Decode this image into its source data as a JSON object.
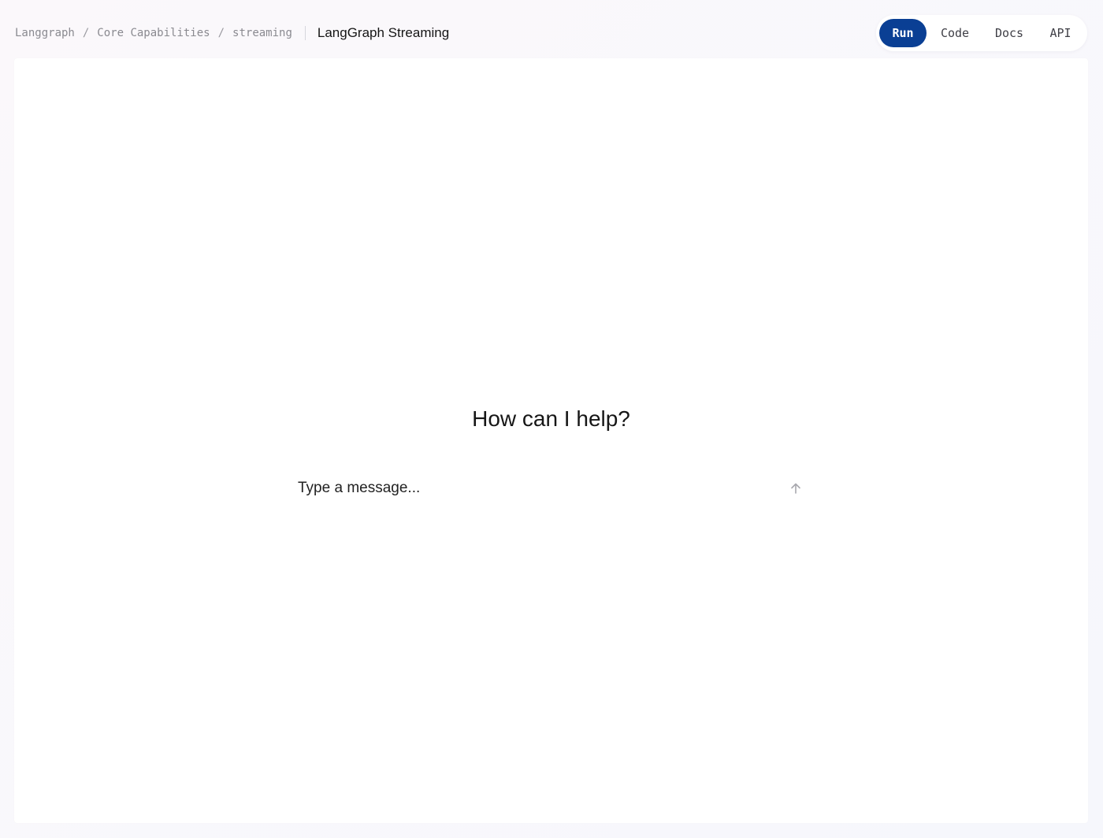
{
  "header": {
    "breadcrumb": {
      "items": [
        "Langgraph",
        "Core Capabilities",
        "streaming"
      ],
      "separator": "/"
    },
    "page_title": "LangGraph Streaming",
    "tabs": [
      {
        "label": "Run",
        "active": true
      },
      {
        "label": "Code",
        "active": false
      },
      {
        "label": "Docs",
        "active": false
      },
      {
        "label": "API",
        "active": false
      }
    ]
  },
  "main": {
    "greeting": "How can I help?",
    "composer": {
      "placeholder": "Type a message...",
      "value": "",
      "send_icon": "arrow-up-icon"
    }
  },
  "colors": {
    "accent": "#0a3f94",
    "background": "#f8f8fc",
    "panel": "#ffffff",
    "muted_text": "#8a8a90"
  }
}
